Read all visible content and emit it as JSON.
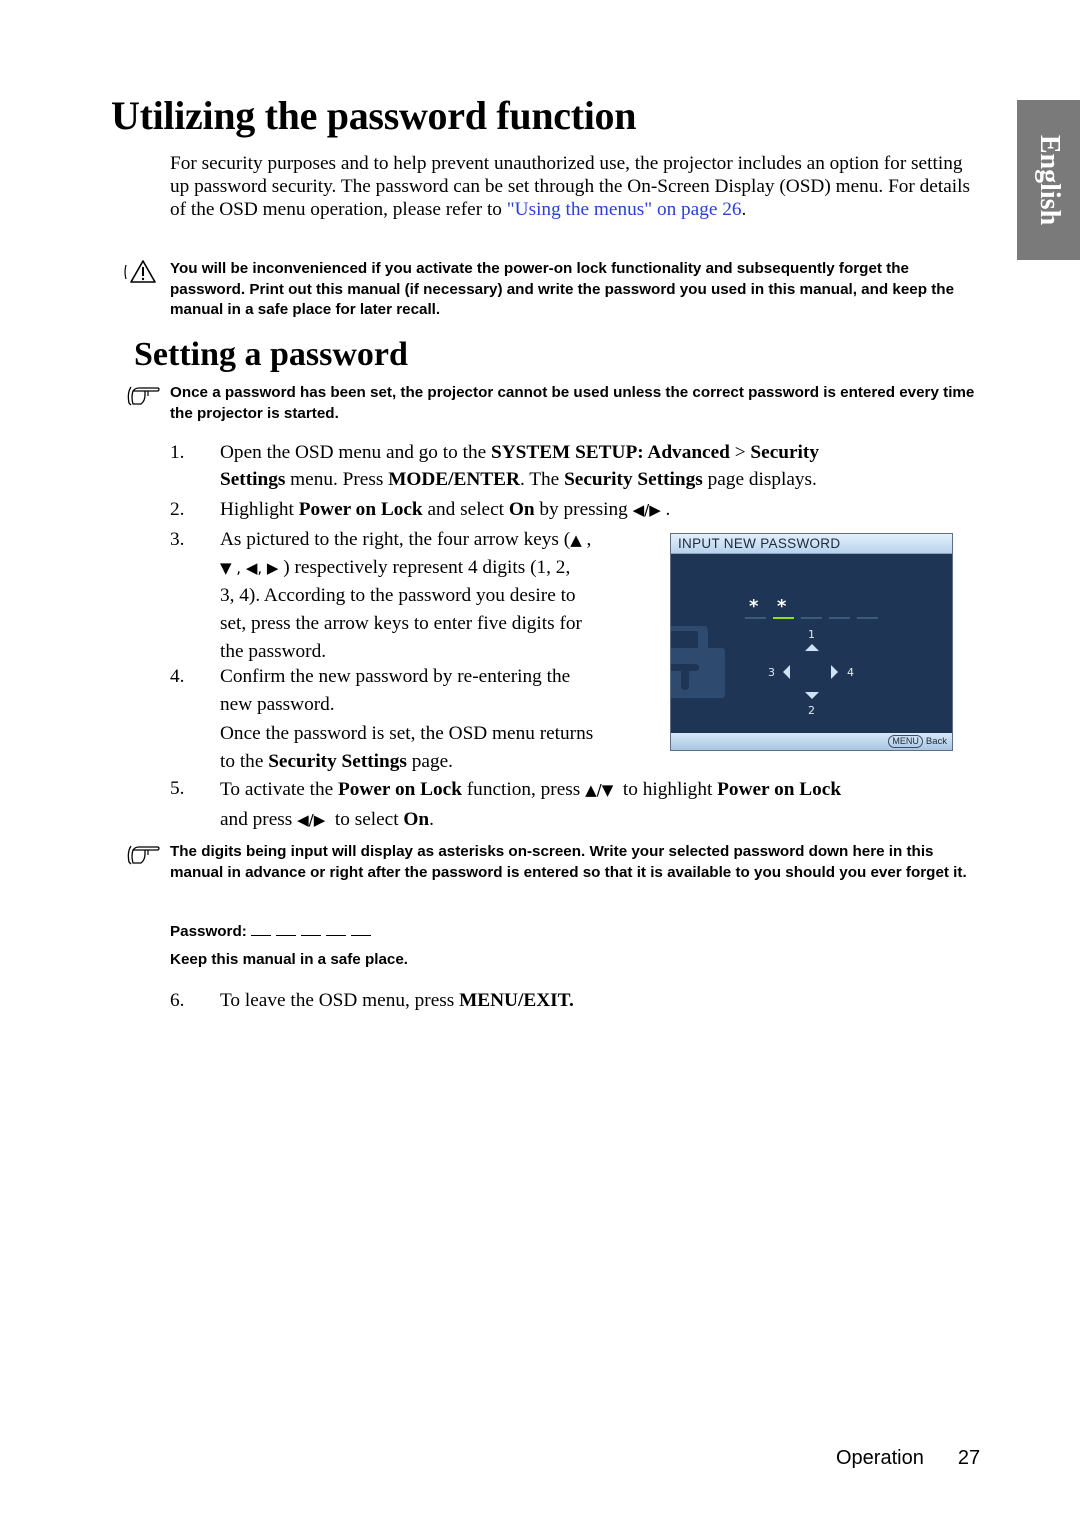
{
  "page": {
    "title": "Utilizing the password function",
    "language_tab": "English",
    "intro": {
      "text": "For security purposes and to help prevent unauthorized use, the projector includes an option for setting up password security. The password can be set through the On-Screen Display (OSD) menu. For details of the OSD menu operation, please refer to ",
      "link": "\"Using the menus\" on page 26",
      "after_link": "."
    },
    "warning_note": "You will be inconvenienced if you activate the power-on lock functionality and subsequently forget the password. Print out this manual (if necessary) and write the password you used in this manual, and keep the manual in a safe place for later recall.",
    "section_title": "Setting a password",
    "tip_note_1": "Once a password has been set, the projector cannot be used unless the correct password is entered every time the projector is started.",
    "steps": [
      {
        "num": "1.",
        "line1_a": "Open the OSD menu and go to the ",
        "line1_b": "SYSTEM SETUP: Advanced",
        "line1_c": " > ",
        "line1_d": "Security",
        "line2_a": "Settings",
        "line2_b": " menu. Press ",
        "line2_c": "MODE/ENTER",
        "line2_d": ". The ",
        "line2_e": "Security Settings",
        "line2_f": " page displays."
      },
      {
        "num": "2.",
        "a": "Highlight ",
        "b": "Power on Lock",
        "c": " and select ",
        "d": "On",
        "e": " by pressing ",
        "keys": "◀/▶",
        "f": " ."
      },
      {
        "num": "3.",
        "line1": "As pictured to the right, the four arrow keys (",
        "line1_key": "▲",
        "line1_end": " ,",
        "line2_keys": "▼ , ◀, ▶",
        "line2": " ) respectively represent 4 digits (1, 2,",
        "line3": "3, 4). According to the password you desire to",
        "line4": "set, press the arrow keys to enter five digits for",
        "line5": "the password."
      },
      {
        "num": "4.",
        "line1": "Confirm the new password by re-entering the",
        "line2": "new password.",
        "line3": "Once the password is set, the OSD menu returns",
        "line4_a": "to the ",
        "line4_b": "Security Settings",
        "line4_c": " page."
      },
      {
        "num": "5.",
        "a": "To activate the ",
        "b": "Power on Lock",
        "c": " function, press ",
        "keys1": "▲/▼",
        "d": "  to highlight ",
        "e": "Power on Lock",
        "line2_a": "and press ",
        "keys2": "◀/▶",
        "line2_b": "  to select ",
        "line2_c": "On",
        "line2_d": "."
      },
      {
        "num": "6.",
        "a": "To leave the OSD menu, press ",
        "b": "MENU/EXIT."
      }
    ],
    "tip_note_2": "The digits being input will display as asterisks on-screen. Write your selected password down here in this manual in advance or right after the password is entered so that it is available to you should you ever forget it.",
    "password_label": "Password:",
    "password_blanks": 5,
    "keep_line": "Keep this manual in a safe place.",
    "footer": {
      "section": "Operation",
      "page_number": "27"
    }
  },
  "osd": {
    "header": "INPUT NEW PASSWORD",
    "entered_mask": [
      "*",
      "*"
    ],
    "total_digits": 5,
    "active_slot": 2,
    "digits": {
      "up": "1",
      "down": "2",
      "left": "3",
      "right": "4"
    },
    "footer_key": "MENU",
    "footer_label": "Back",
    "colors": {
      "background": "#1f3556",
      "header": "#cfe2f5",
      "active_slot": "#8fdd1c",
      "slot": "#3c5a7c",
      "lock_icon": "#2e4a6f"
    }
  },
  "colors": {
    "link": "#2a3fd8",
    "language_tab": "#7a7a7a"
  }
}
